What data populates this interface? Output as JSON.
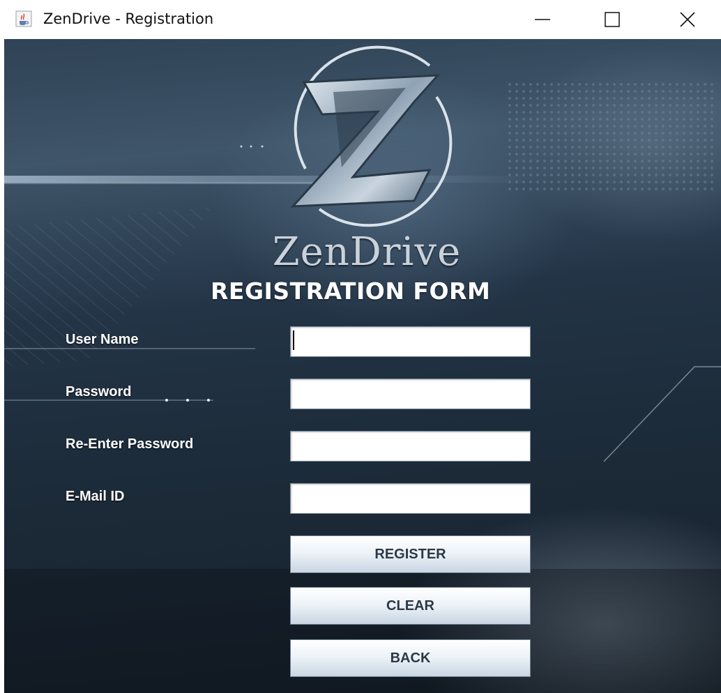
{
  "window": {
    "title": "ZenDrive - Registration",
    "app_icon": "java-cup-icon",
    "controls": [
      "minimize-icon",
      "maximize-icon",
      "close-icon"
    ]
  },
  "brand": {
    "logo_icon": "zendrive-z-logo",
    "name": "ZenDrive"
  },
  "form": {
    "title": "REGISTRATION FORM",
    "fields": [
      {
        "label": "User Name",
        "value": "",
        "focused": true
      },
      {
        "label": "Password",
        "value": ""
      },
      {
        "label": "Re-Enter Password",
        "value": ""
      },
      {
        "label": "E-Mail ID",
        "value": ""
      }
    ],
    "buttons": {
      "register": "REGISTER",
      "clear": "CLEAR",
      "back": "BACK"
    }
  },
  "colors": {
    "background_dark": "#1d2d3c",
    "background_light": "#3f5569",
    "label_text": "#ffffff",
    "button_text": "#2c3946",
    "button_gradient_bottom": "#c9d6e3"
  }
}
